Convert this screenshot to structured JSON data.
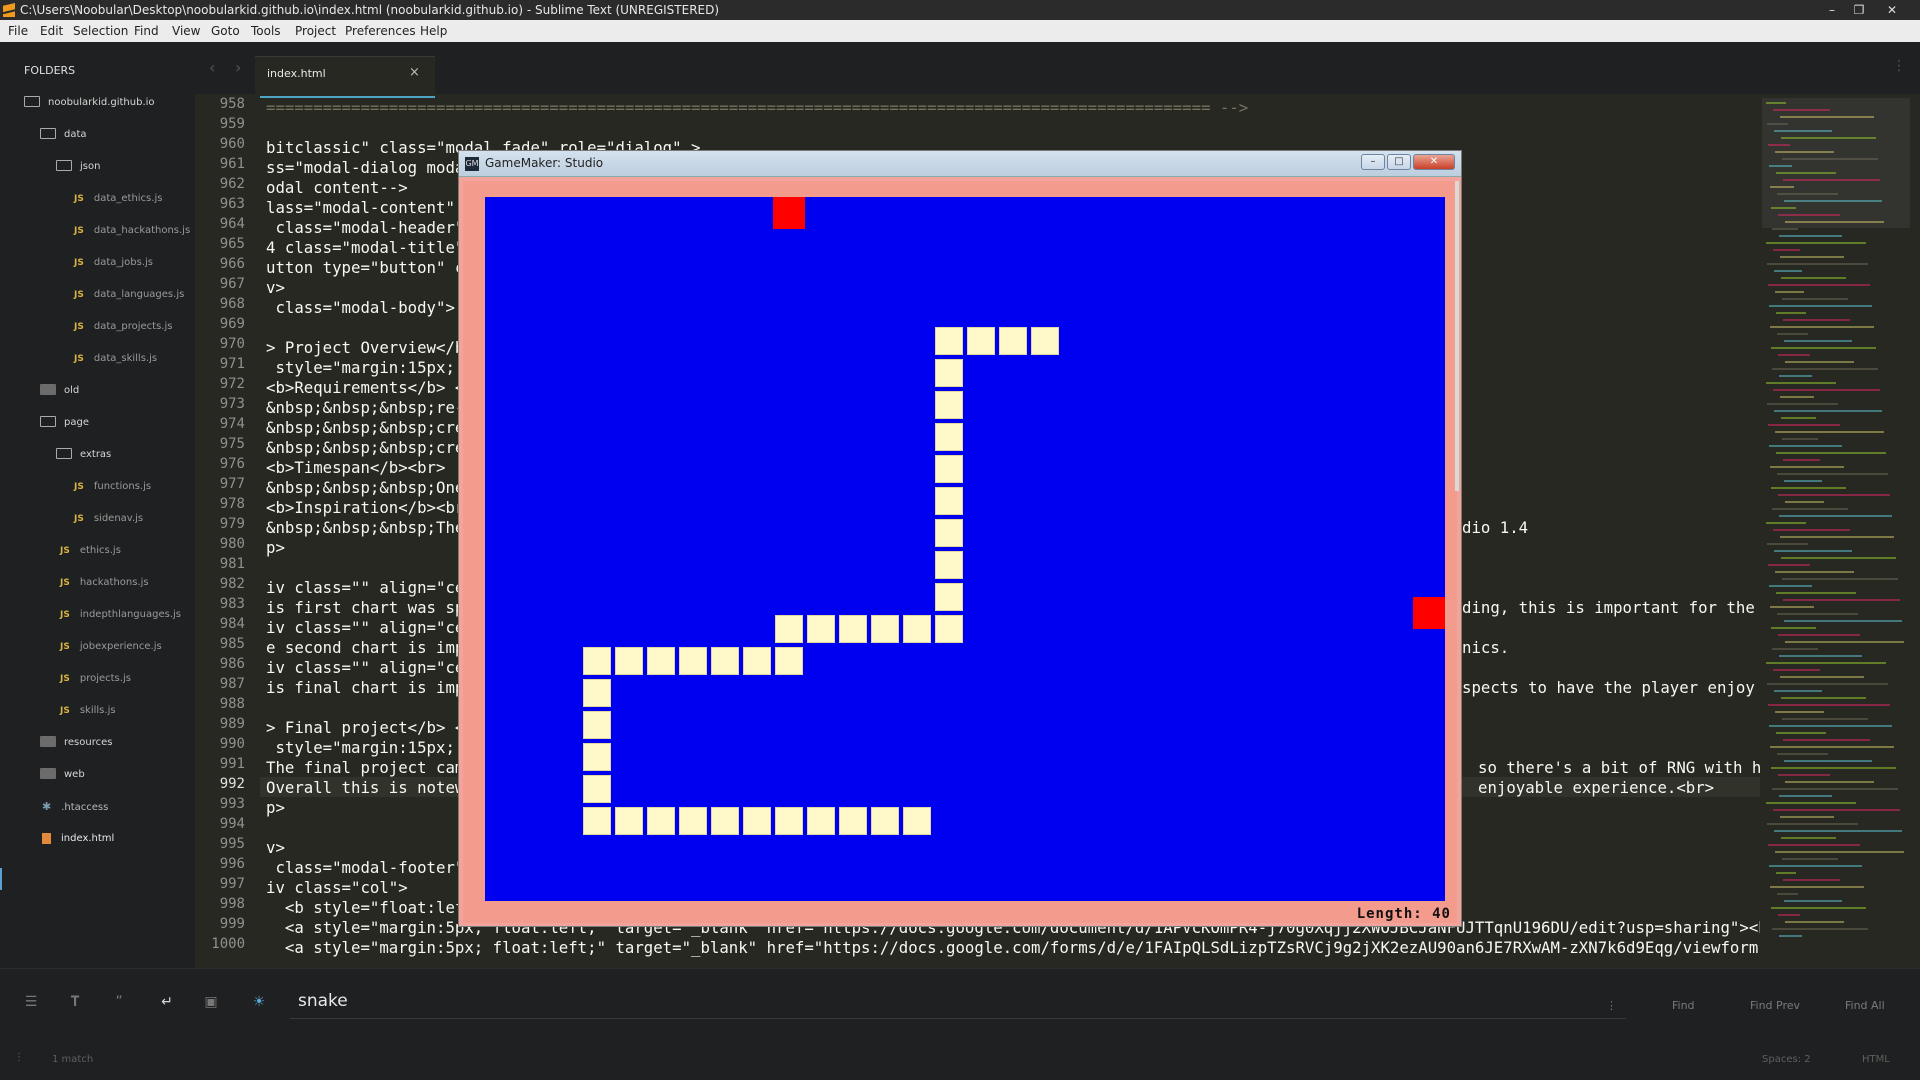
{
  "window": {
    "title": "C:\\Users\\Noobular\\Desktop\\noobularkid.github.io\\index.html (noobularkid.github.io) - Sublime Text (UNREGISTERED)",
    "controls": [
      "–",
      "❐",
      "✕"
    ]
  },
  "menu": [
    "File",
    "Edit",
    "Selection",
    "Find",
    "View",
    "Goto",
    "Tools",
    "Project",
    "Preferences",
    "Help"
  ],
  "sidebar": {
    "header": "FOLDERS",
    "tree": [
      {
        "label": "noobularkid.github.io",
        "kind": "folder-open"
      },
      {
        "label": "data",
        "kind": "folder-open"
      },
      {
        "label": "json",
        "kind": "folder-open"
      },
      {
        "label": "data_ethics.js",
        "kind": "js"
      },
      {
        "label": "data_hackathons.js",
        "kind": "js"
      },
      {
        "label": "data_jobs.js",
        "kind": "js"
      },
      {
        "label": "data_languages.js",
        "kind": "js"
      },
      {
        "label": "data_projects.js",
        "kind": "js"
      },
      {
        "label": "data_skills.js",
        "kind": "js"
      },
      {
        "label": "old",
        "kind": "folder-closed"
      },
      {
        "label": "page",
        "kind": "folder-open"
      },
      {
        "label": "extras",
        "kind": "folder-open"
      },
      {
        "label": "functions.js",
        "kind": "js"
      },
      {
        "label": "sidenav.js",
        "kind": "js"
      },
      {
        "label": "ethics.js",
        "kind": "js"
      },
      {
        "label": "hackathons.js",
        "kind": "js"
      },
      {
        "label": "indepthlanguages.js",
        "kind": "js"
      },
      {
        "label": "jobexperience.js",
        "kind": "js"
      },
      {
        "label": "projects.js",
        "kind": "js"
      },
      {
        "label": "skills.js",
        "kind": "js"
      },
      {
        "label": "resources",
        "kind": "folder-closed"
      },
      {
        "label": "web",
        "kind": "folder-closed"
      },
      {
        "label": ".htaccess",
        "kind": "other"
      },
      {
        "label": "index.html",
        "kind": "html"
      }
    ]
  },
  "tab": {
    "label": "index.html",
    "close": "×"
  },
  "editor": {
    "line_numbers": [
      "958",
      "959",
      "960",
      "961",
      "962",
      "963",
      "964",
      "965",
      "966",
      "967",
      "968",
      "969",
      "970",
      "971",
      "972",
      "973",
      "974",
      "975",
      "976",
      "977",
      "978",
      "979",
      "980",
      "981",
      "982",
      "983",
      "984",
      "985",
      "986",
      "987",
      "988",
      "989",
      "990",
      "991",
      "992",
      "993",
      "994",
      "995",
      "996",
      "997",
      "998",
      "999",
      "1000"
    ],
    "current_line": "992",
    "lines": [
      "==================================================================================================== -->",
      "",
      "bitclassic\" class=\"modal fade\" role=\"dialog\" >",
      "ss=\"modal-dialog moda",
      "odal content-->",
      "lass=\"modal-content\" ",
      " class=\"modal-header\" ",
      "4 class=\"modal-title\" ",
      "utton type=\"button\" c",
      "v>",
      " class=\"modal-body\">",
      "",
      "> Project Overview</b",
      " style=\"margin:15px; ",
      "<b>Requirements</b> <",
      "&nbsp;&nbsp;&nbsp;re-",
      "&nbsp;&nbsp;&nbsp;cre",
      "&nbsp;&nbsp;&nbsp;cre",
      "<b>Timespan</b><br>",
      "&nbsp;&nbsp;&nbsp;One",
      "<b>Inspiration</b><br",
      "&nbsp;&nbsp;&nbsp;The",
      "p>",
      "",
      "iv class=\"\" align=\"cen",
      "is first chart was spe",
      "iv class=\"\" align=\"cen",
      "e second chart is impo",
      "iv class=\"\" align=\"cen",
      "is final chart is impo",
      "",
      "> Final project</b> <",
      " style=\"margin:15px; ",
      "The final project came",
      "Overall this is notewo",
      "p>",
      "",
      "v>",
      " class=\"modal-footer\"",
      "iv class=\"col\">",
      "  <b style=\"float:left",
      "  <a style=\"margin:5px; float:left;\" target=\"_blank\" href=\"https://docs.google.com/document/d/1APVcKOmPR4-j70g0Xqjj2XWOJBCJaNFUJTTqnU196DU/edit?usp=sharing\"><button t",
      "  <a style=\"margin:5px; float:left;\" target=\"_blank\" href=\"https://docs.google.com/forms/d/e/1FAIpQLSdLizpTZsRVCj9g2jXK2ezAU90an6JE7RXwAM-zXN7k6d9Eqg/viewform\"><butto"
    ],
    "right_fragments": [
      {
        "line": "979",
        "text": "dio 1.4"
      },
      {
        "line": "983",
        "text": "ding, this is important for the i"
      },
      {
        "line": "985",
        "text": "nics."
      },
      {
        "line": "987",
        "text": "spects to have the player enjoy t"
      },
      {
        "line": "991",
        "text": "so there's a bit of RNG with how"
      },
      {
        "line": "992",
        "text": "enjoyable experience.<br>"
      }
    ]
  },
  "find": {
    "query": "snake",
    "find_label": "Find",
    "find_prev_label": "Find Prev",
    "find_all_label": "Find All",
    "option_icons": [
      "regex-icon",
      "case-icon",
      "whole-word-icon",
      "wrap-icon",
      "in-selection-icon",
      "highlight-icon"
    ]
  },
  "status": {
    "matches": "1 match",
    "spaces": "Spaces: 2",
    "syntax": "HTML"
  },
  "game": {
    "title": "GameMaker: Studio",
    "length_label": "Length: 40",
    "grid_cell": 32,
    "snake": [
      [
        14,
        4
      ],
      [
        15,
        4
      ],
      [
        16,
        4
      ],
      [
        17,
        4
      ],
      [
        14,
        5
      ],
      [
        14,
        6
      ],
      [
        14,
        7
      ],
      [
        14,
        8
      ],
      [
        14,
        9
      ],
      [
        14,
        10
      ],
      [
        14,
        11
      ],
      [
        14,
        12
      ],
      [
        9,
        13
      ],
      [
        10,
        13
      ],
      [
        11,
        13
      ],
      [
        12,
        13
      ],
      [
        13,
        13
      ],
      [
        14,
        13
      ],
      [
        3,
        14
      ],
      [
        4,
        14
      ],
      [
        5,
        14
      ],
      [
        6,
        14
      ],
      [
        7,
        14
      ],
      [
        8,
        14
      ],
      [
        9,
        14
      ],
      [
        3,
        15
      ],
      [
        3,
        16
      ],
      [
        3,
        17
      ],
      [
        3,
        18
      ],
      [
        3,
        19
      ],
      [
        4,
        19
      ],
      [
        5,
        19
      ],
      [
        6,
        19
      ],
      [
        7,
        19
      ],
      [
        8,
        19
      ],
      [
        9,
        19
      ],
      [
        10,
        19
      ],
      [
        11,
        19
      ],
      [
        12,
        19
      ],
      [
        13,
        19
      ]
    ],
    "food": [
      [
        9,
        0
      ],
      [
        29,
        12.5
      ]
    ],
    "colors": {
      "field": "#0000f0",
      "snake": "#fff8c8",
      "food": "#ff0000",
      "border": "#f39b8d"
    }
  }
}
